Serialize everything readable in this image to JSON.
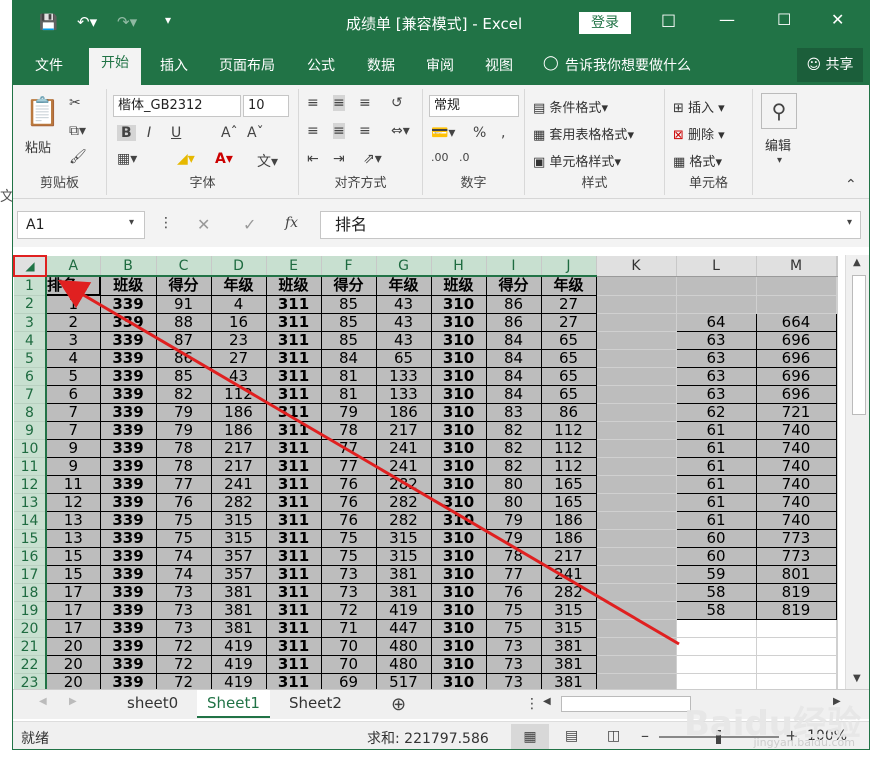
{
  "window": {
    "title": "成绩单  [兼容模式]  -  Excel",
    "login_label": "登录",
    "accent_color": "#217346"
  },
  "tabs": [
    "文件",
    "开始",
    "插入",
    "页面布局",
    "公式",
    "数据",
    "审阅",
    "视图"
  ],
  "tell_me": "告诉我你想要做什么",
  "share_label": "共享",
  "ribbon": {
    "clipboard": {
      "label": "剪贴板",
      "paste": "粘贴"
    },
    "font": {
      "label": "字体",
      "font_name": "楷体_GB2312",
      "font_size": "10",
      "bold": "B",
      "italic": "I",
      "underline": "U"
    },
    "alignment": {
      "label": "对齐方式"
    },
    "number": {
      "label": "数字",
      "format": "常规"
    },
    "styles": {
      "label": "样式",
      "conditional": "条件格式",
      "table": "套用表格格式",
      "cell_styles": "单元格样式"
    },
    "cells": {
      "label": "单元格",
      "insert": "插入",
      "delete": "删除",
      "format": "格式"
    },
    "editing": {
      "label": "编辑"
    }
  },
  "formula_bar": {
    "name_box": "A1",
    "fx": "fx",
    "value": "排名"
  },
  "columns": [
    "A",
    "B",
    "C",
    "D",
    "E",
    "F",
    "G",
    "H",
    "I",
    "J",
    "K",
    "L",
    "M"
  ],
  "row_numbers": [
    "1",
    "2",
    "3",
    "4",
    "5",
    "6",
    "7",
    "8",
    "9",
    "10",
    "11",
    "12",
    "13",
    "14",
    "15",
    "16",
    "17",
    "18",
    "19",
    "20",
    "21",
    "22",
    "23"
  ],
  "header_row": [
    "排名",
    "班级",
    "得分",
    "年级",
    "班级",
    "得分",
    "年级",
    "班级",
    "得分",
    "年级"
  ],
  "rows": [
    [
      "1",
      "339",
      "91",
      "4",
      "311",
      "85",
      "43",
      "310",
      "86",
      "27"
    ],
    [
      "2",
      "339",
      "88",
      "16",
      "311",
      "85",
      "43",
      "310",
      "86",
      "27"
    ],
    [
      "3",
      "339",
      "87",
      "23",
      "311",
      "85",
      "43",
      "310",
      "84",
      "65"
    ],
    [
      "4",
      "339",
      "86",
      "27",
      "311",
      "84",
      "65",
      "310",
      "84",
      "65"
    ],
    [
      "5",
      "339",
      "85",
      "43",
      "311",
      "81",
      "133",
      "310",
      "84",
      "65"
    ],
    [
      "6",
      "339",
      "82",
      "112",
      "311",
      "81",
      "133",
      "310",
      "84",
      "65"
    ],
    [
      "7",
      "339",
      "79",
      "186",
      "311",
      "79",
      "186",
      "310",
      "83",
      "86"
    ],
    [
      "7",
      "339",
      "79",
      "186",
      "311",
      "78",
      "217",
      "310",
      "82",
      "112"
    ],
    [
      "9",
      "339",
      "78",
      "217",
      "311",
      "77",
      "241",
      "310",
      "82",
      "112"
    ],
    [
      "9",
      "339",
      "78",
      "217",
      "311",
      "77",
      "241",
      "310",
      "82",
      "112"
    ],
    [
      "11",
      "339",
      "77",
      "241",
      "311",
      "76",
      "282",
      "310",
      "80",
      "165"
    ],
    [
      "12",
      "339",
      "76",
      "282",
      "311",
      "76",
      "282",
      "310",
      "80",
      "165"
    ],
    [
      "13",
      "339",
      "75",
      "315",
      "311",
      "76",
      "282",
      "310",
      "79",
      "186"
    ],
    [
      "13",
      "339",
      "75",
      "315",
      "311",
      "75",
      "315",
      "310",
      "79",
      "186"
    ],
    [
      "15",
      "339",
      "74",
      "357",
      "311",
      "75",
      "315",
      "310",
      "78",
      "217"
    ],
    [
      "15",
      "339",
      "74",
      "357",
      "311",
      "73",
      "381",
      "310",
      "77",
      "241"
    ],
    [
      "17",
      "339",
      "73",
      "381",
      "311",
      "73",
      "381",
      "310",
      "76",
      "282"
    ],
    [
      "17",
      "339",
      "73",
      "381",
      "311",
      "72",
      "419",
      "310",
      "75",
      "315"
    ],
    [
      "17",
      "339",
      "73",
      "381",
      "311",
      "71",
      "447",
      "310",
      "75",
      "315"
    ],
    [
      "20",
      "339",
      "72",
      "419",
      "311",
      "70",
      "480",
      "310",
      "73",
      "381"
    ],
    [
      "20",
      "339",
      "72",
      "419",
      "311",
      "70",
      "480",
      "310",
      "73",
      "381"
    ],
    [
      "20",
      "339",
      "72",
      "419",
      "311",
      "69",
      "517",
      "310",
      "73",
      "381"
    ]
  ],
  "side_table": [
    [
      "64",
      "664"
    ],
    [
      "63",
      "696"
    ],
    [
      "63",
      "696"
    ],
    [
      "63",
      "696"
    ],
    [
      "63",
      "696"
    ],
    [
      "62",
      "721"
    ],
    [
      "61",
      "740"
    ],
    [
      "61",
      "740"
    ],
    [
      "61",
      "740"
    ],
    [
      "61",
      "740"
    ],
    [
      "61",
      "740"
    ],
    [
      "61",
      "740"
    ],
    [
      "60",
      "773"
    ],
    [
      "60",
      "773"
    ],
    [
      "59",
      "801"
    ],
    [
      "58",
      "819"
    ],
    [
      "58",
      "819"
    ]
  ],
  "sheets": [
    "sheet0",
    "Sheet1",
    "Sheet2"
  ],
  "active_sheet": "Sheet1",
  "status": {
    "ready": "就绪",
    "sum": "求和: 221797.586",
    "zoom": "100%"
  },
  "watermark": {
    "brand": "Baidu经验",
    "url": "jingyan.baidu.com"
  }
}
